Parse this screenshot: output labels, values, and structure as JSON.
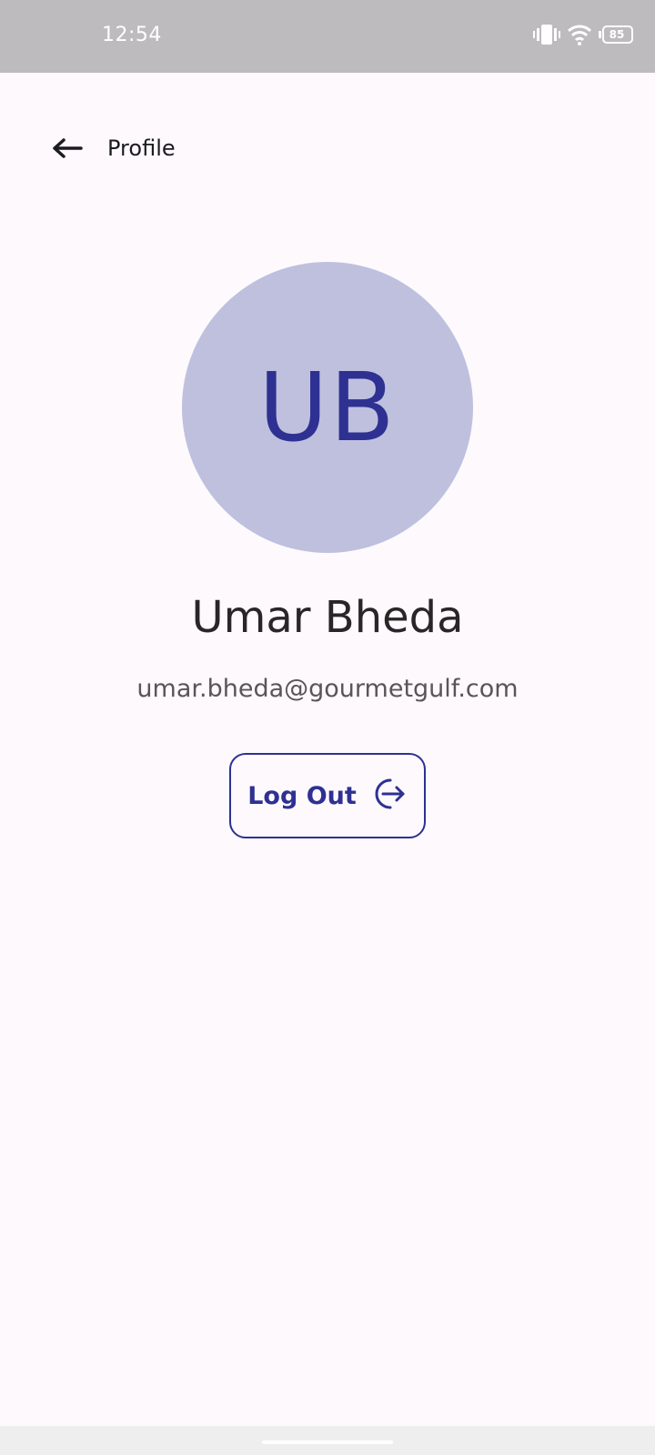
{
  "status_bar": {
    "time": "12:54",
    "battery_level": "85",
    "icons": [
      "vibrate-icon",
      "wifi-icon",
      "battery-icon"
    ]
  },
  "app_bar": {
    "title": "Profile",
    "back_icon": "arrow-left-icon"
  },
  "profile": {
    "initials": "UB",
    "name": "Umar Bheda",
    "email": "umar.bheda@gourmetgulf.com"
  },
  "actions": {
    "logout_label": "Log Out",
    "logout_icon": "logout-icon"
  },
  "colors": {
    "primary": "#2e3192",
    "avatar_background": "#bfc0de",
    "page_background": "#fdf9fd",
    "status_bar": "#bdbbbd"
  }
}
